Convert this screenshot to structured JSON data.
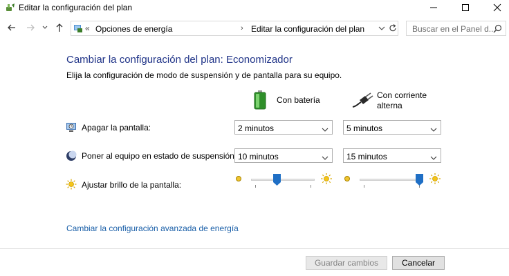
{
  "window": {
    "title": "Editar la configuración del plan"
  },
  "address": {
    "prefix": "«",
    "crumb1": "Opciones de energía",
    "separator": "›",
    "crumb2": "Editar la configuración del plan"
  },
  "search": {
    "placeholder": "Buscar en el Panel d..."
  },
  "content": {
    "heading": "Cambiar la configuración del plan: Economizador",
    "subtitle": "Elija la configuración de modo de suspensión y de pantalla para su equipo.",
    "battery_label": "Con batería",
    "ac_label": "Con corriente alterna"
  },
  "rows": {
    "display_off": {
      "label": "Apagar la pantalla:",
      "battery_value": "2 minutos",
      "ac_value": "5 minutos"
    },
    "sleep": {
      "label": "Poner al equipo en estado de suspensión:",
      "battery_value": "10 minutos",
      "ac_value": "15 minutos"
    },
    "brightness": {
      "label": "Ajustar brillo de la pantalla:",
      "battery_level": 0.4,
      "ac_level": 1.0
    }
  },
  "advanced_link": "Cambiar la configuración avanzada de energía",
  "buttons": {
    "save": "Guardar cambios",
    "cancel": "Cancelar"
  },
  "colors": {
    "heading": "#1e3287",
    "link": "#1a5fa8",
    "slider_thumb": "#1f6fc5",
    "battery_green": "#3aa435"
  }
}
